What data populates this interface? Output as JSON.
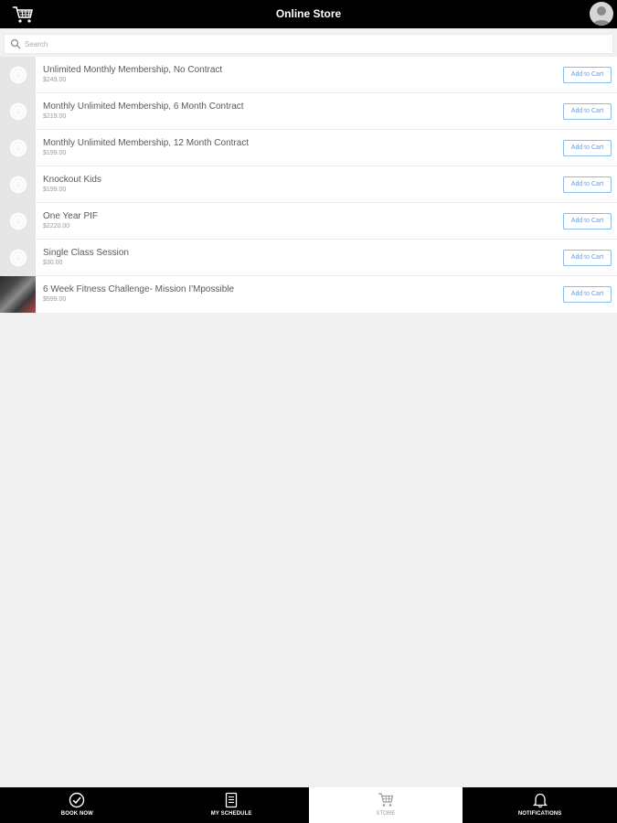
{
  "header": {
    "title": "Online Store",
    "cart_icon": "shopping-cart-icon",
    "avatar_icon": "user-avatar-icon"
  },
  "search": {
    "placeholder": "Search",
    "value": ""
  },
  "products": [
    {
      "name": "Unlimited Monthly Membership, No Contract",
      "price": "$249.00",
      "button": "Add to Cart",
      "thumb": "placeholder"
    },
    {
      "name": "Monthly Unlimited Membership, 6 Month Contract",
      "price": "$219.00",
      "button": "Add to Cart",
      "thumb": "placeholder"
    },
    {
      "name": "Monthly Unlimited Membership, 12 Month Contract",
      "price": "$199.00",
      "button": "Add to Cart",
      "thumb": "placeholder"
    },
    {
      "name": "Knockout Kids",
      "price": "$199.00",
      "button": "Add to Cart",
      "thumb": "placeholder"
    },
    {
      "name": "One Year PIF",
      "price": "$2220.00",
      "button": "Add to Cart",
      "thumb": "placeholder"
    },
    {
      "name": "Single Class Session",
      "price": "$30.00",
      "button": "Add to Cart",
      "thumb": "placeholder"
    },
    {
      "name": "6 Week Fitness Challenge- Mission I'Mpossible",
      "price": "$599.00",
      "button": "Add to Cart",
      "thumb": "photo"
    }
  ],
  "bottom_nav": [
    {
      "label": "BOOK NOW",
      "icon": "check-circle-icon",
      "active": false
    },
    {
      "label": "MY SCHEDULE",
      "icon": "schedule-list-icon",
      "active": false
    },
    {
      "label": "STORE",
      "icon": "shopping-cart-icon",
      "active": true
    },
    {
      "label": "NOTIFICATIONS",
      "icon": "bell-icon",
      "active": false
    }
  ],
  "colors": {
    "header_bg": "#000000",
    "accent_blue": "#6d9bd6",
    "page_bg": "#f1f1f1"
  }
}
